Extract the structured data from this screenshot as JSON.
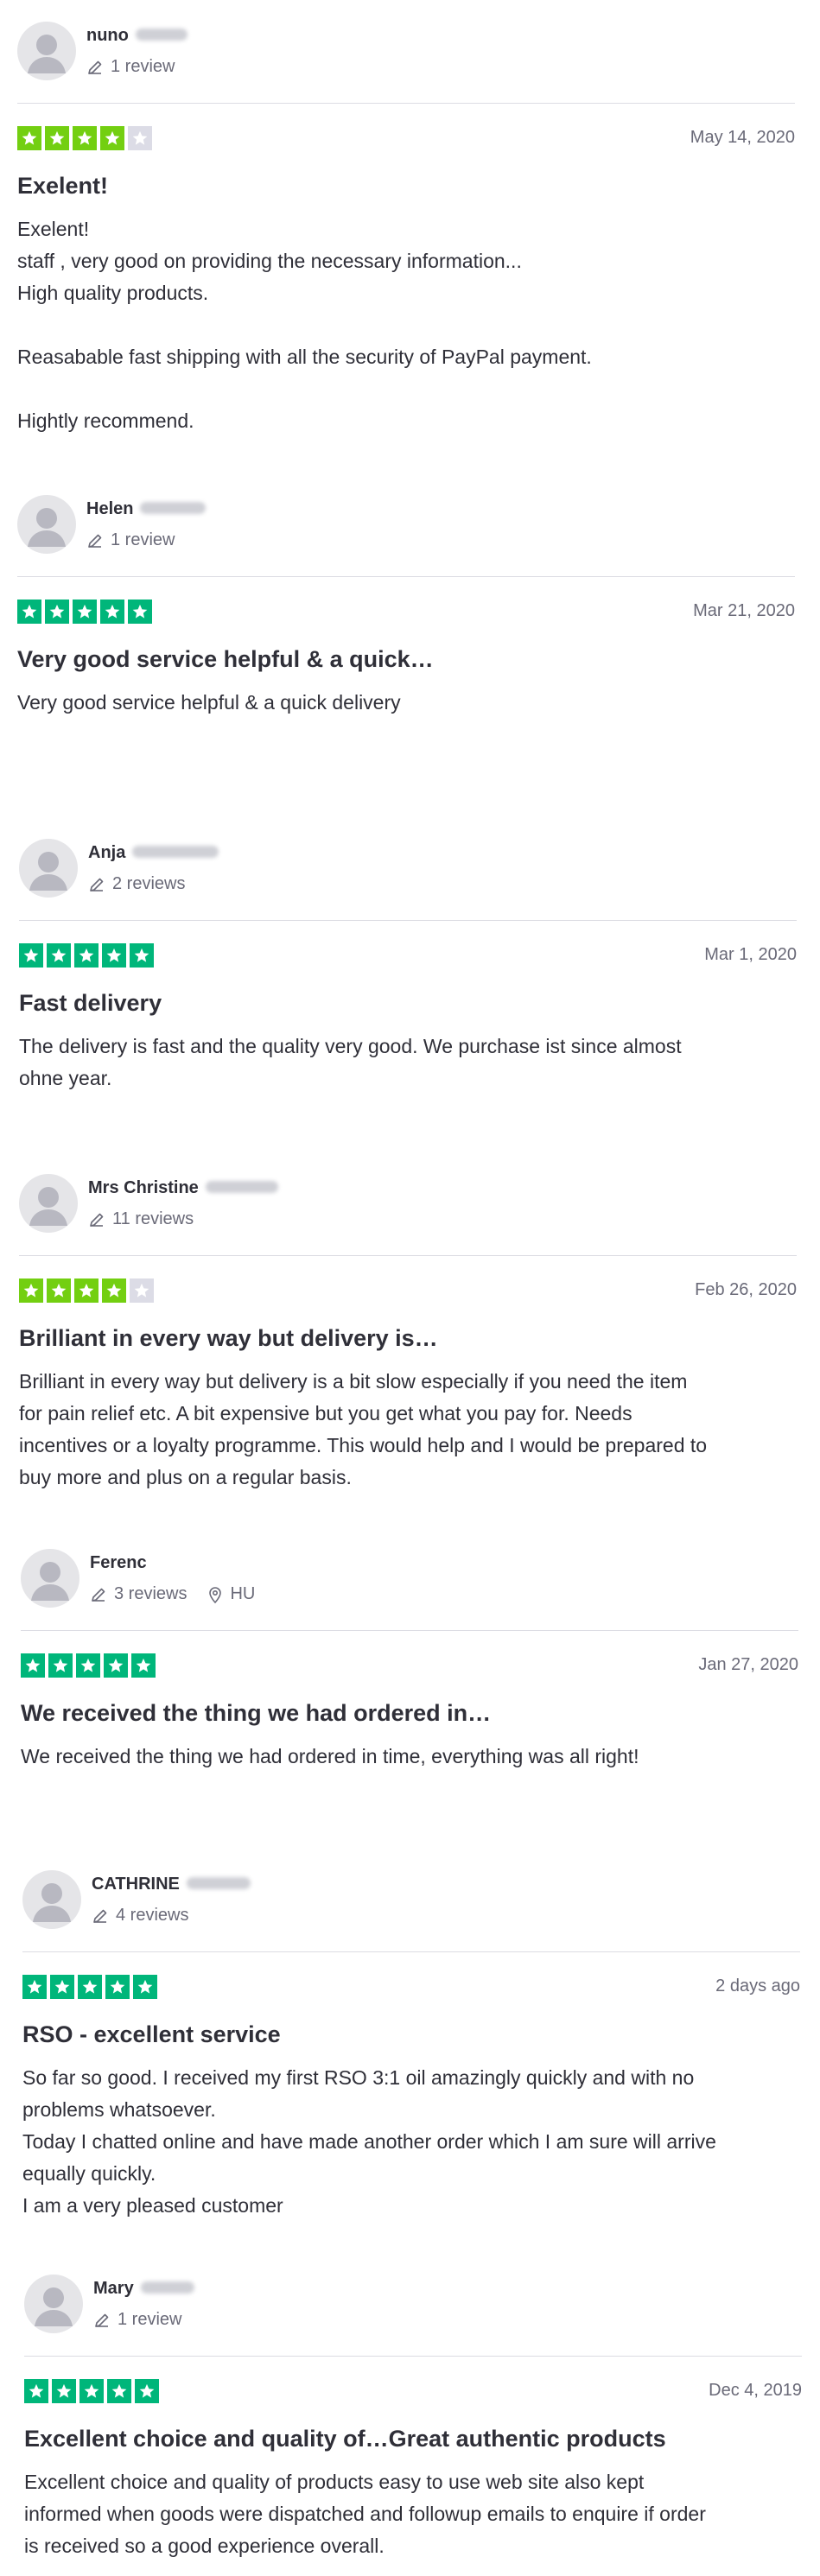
{
  "colors": {
    "star_green_full": "#00b67a",
    "star_green_four": "#73cf11",
    "star_empty": "#dcdce6",
    "text": "#2f2f38",
    "muted": "#6a6a78"
  },
  "reviews": [
    {
      "name": "nuno",
      "count": "1 review",
      "location": "",
      "rating": 4,
      "date": "May 14, 2020",
      "title": "Exelent!",
      "lines": [
        "Exelent!",
        "staff , very good on providing the necessary information...",
        "High quality products.",
        "",
        "Reasabable fast shipping with all the security of PayPal payment.",
        "",
        "Hightly recommend."
      ]
    },
    {
      "name": "Helen",
      "count": "1 review",
      "location": "",
      "rating": 5,
      "date": "Mar 21, 2020",
      "title": "Very good service helpful & a quick…",
      "lines": [
        "Very good service helpful & a quick delivery"
      ]
    },
    {
      "name": "Anja",
      "count": "2 reviews",
      "location": "",
      "rating": 5,
      "date": "Mar 1, 2020",
      "title": "Fast delivery",
      "lines": [
        "The delivery is fast and the quality very good. We purchase ist since almost",
        "ohne year."
      ]
    },
    {
      "name": "Mrs Christine",
      "count": "11 reviews",
      "location": "",
      "rating": 4,
      "date": "Feb 26, 2020",
      "title": "Brilliant in every way but delivery is…",
      "lines": [
        "Brilliant in every way but delivery is a bit slow especially if you need the item",
        "for pain relief etc. A bit expensive but you get what you pay for. Needs",
        "incentives or a loyalty programme. This would help and I would be prepared to",
        "buy more and plus on a regular basis."
      ]
    },
    {
      "name": "Ferenc",
      "count": "3 reviews",
      "location": "HU",
      "rating": 5,
      "date": "Jan 27, 2020",
      "title": "We received the thing we had ordered in…",
      "lines": [
        "We received the thing we had ordered in time, everything was all right!"
      ]
    },
    {
      "name": "CATHRINE",
      "count": "4 reviews",
      "location": "",
      "rating": 5,
      "date": "2 days ago",
      "title": "RSO - excellent service",
      "lines": [
        "So far so good. I received my first RSO 3:1 oil amazingly quickly and with no",
        "problems whatsoever.",
        "Today I chatted online and have made another order which I am sure will arrive",
        "equally quickly.",
        "I am a very pleased customer"
      ]
    },
    {
      "name": "Mary",
      "count": "1 review",
      "location": "",
      "rating": 5,
      "date": "Dec 4, 2019",
      "title": "Excellent choice and quality of…Great authentic products",
      "lines": [
        "Excellent choice and quality of products easy to use web site also kept",
        "informed when goods were dispatched and followup emails to enquire if order",
        "is received so a good experience overall."
      ]
    }
  ]
}
